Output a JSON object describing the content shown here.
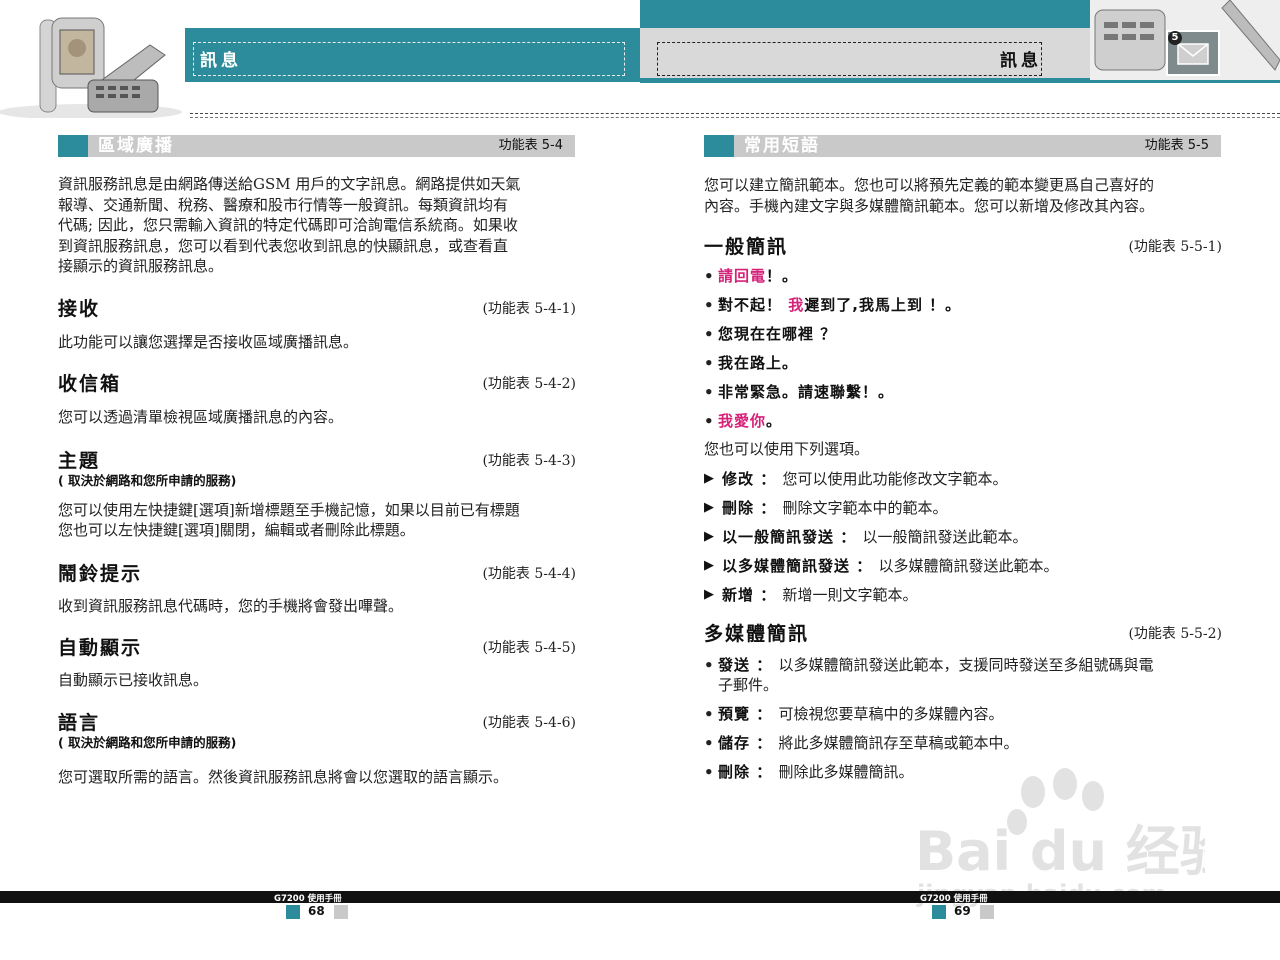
{
  "colors": {
    "teal": "#2c8c9b",
    "gray_bar": "#c9c9c9",
    "pink": "#d6237a"
  },
  "header": {
    "left_title": "訊息",
    "right_title": "訊息",
    "badge": "5",
    "icon_names": [
      "phone-flip-image",
      "envelope-icon"
    ]
  },
  "left": {
    "bar": {
      "title": "區域廣播",
      "ref": "功能表  5-4"
    },
    "intro": [
      "資訊服務訊息是由網路傳送給GSM 用戶的文字訊息。網路提供如天氣",
      "報導、交通新聞、稅務、醫療和股市行情等一般資訊。每類資訊均有",
      "代碼; 因此，您只需輸入資訊的特定代碼即可洽詢電信系統商。如果收",
      "到資訊服務訊息，您可以看到代表您收到訊息的快顯訊息，或查看直",
      "接顯示的資訊服務訊息。"
    ],
    "sections": [
      {
        "title": "接收",
        "ref": "(功能表 5-4-1)",
        "note": "",
        "body": [
          "此功能可以讓您選擇是否接收區域廣播訊息。"
        ]
      },
      {
        "title": "收信箱",
        "ref": "(功能表 5-4-2)",
        "note": "",
        "body": [
          "您可以透過清單檢視區域廣播訊息的內容。"
        ]
      },
      {
        "title": "主題",
        "ref": "(功能表 5-4-3)",
        "note": "( 取決於網路和您所申請的服務)",
        "body": [
          "您可以使用左快捷鍵[選項]新增標題至手機記憶，如果以目前已有標題",
          "您也可以左快捷鍵[選項]關閉，編輯或者刪除此標題。"
        ]
      },
      {
        "title": "鬧鈴提示",
        "ref": "(功能表 5-4-4)",
        "note": "",
        "body": [
          "收到資訊服務訊息代碼時，您的手機將會發出嗶聲。"
        ]
      },
      {
        "title": "自動顯示",
        "ref": "(功能表 5-4-5)",
        "note": "",
        "body": [
          "自動顯示已接收訊息。"
        ]
      },
      {
        "title": "語言",
        "ref": "(功能表 5-4-6)",
        "note": "( 取決於網路和您所申請的服務)",
        "body": [
          "您可選取所需的語言。然後資訊服務訊息將會以您選取的語言顯示。"
        ]
      }
    ]
  },
  "right": {
    "bar": {
      "title": "常用短語",
      "ref": "功能表  5-5"
    },
    "intro": [
      "您可以建立簡訊範本。您也可以將預先定義的範本變更爲自己喜好的",
      "內容。手機內建文字與多媒體簡訊範本。您可以新增及修改其內容。"
    ],
    "general": {
      "title": "一般簡訊",
      "ref": "(功能表 5-5-1)",
      "templates": [
        {
          "pre": "",
          "hl": "請回電",
          "post": "！。"
        },
        {
          "pre": "對不起！ ",
          "hl": "我",
          "post": "遲到了,我馬上到  ！。"
        },
        {
          "pre": "您現在在哪裡  ？",
          "hl": "",
          "post": ""
        },
        {
          "pre": "我在路上。",
          "hl": "",
          "post": ""
        },
        {
          "pre": "非常緊急。請速聯繫！。",
          "hl": "",
          "post": ""
        },
        {
          "pre": "",
          "hl": "我愛你",
          "post": "。"
        }
      ],
      "options_intro": "您也可以使用下列選項。",
      "options": [
        {
          "label": "修改",
          "sep": " ： ",
          "desc": "您可以使用此功能修改文字範本。"
        },
        {
          "label": "刪除",
          "sep": " ： ",
          "desc": "刪除文字範本中的範本。"
        },
        {
          "label": "以一般簡訊發送",
          "sep": " ： ",
          "desc": "以一般簡訊發送此範本。"
        },
        {
          "label": "以多媒體簡訊發送",
          "sep": " ： ",
          "desc": "以多媒體簡訊發送此範本。"
        },
        {
          "label": "新增",
          "sep": " ： ",
          "desc": "新增一則文字範本。"
        }
      ]
    },
    "mms": {
      "title": "多媒體簡訊",
      "ref": "(功能表 5-5-2)",
      "items": [
        {
          "label": "發送",
          "sep": " ： ",
          "desc": "以多媒體簡訊發送此範本，支援同時發送至多組號碼與電",
          "desc2": "子郵件。"
        },
        {
          "label": "預覽",
          "sep": " ： ",
          "desc": "可檢視您要草稿中的多媒體內容。",
          "desc2": ""
        },
        {
          "label": "儲存",
          "sep": " ： ",
          "desc": "將此多媒體簡訊存至草稿或範本中。",
          "desc2": ""
        },
        {
          "label": "刪除",
          "sep": " ： ",
          "desc": "刪除此多媒體簡訊。",
          "desc2": ""
        }
      ]
    }
  },
  "footer": {
    "left_label": "G7200 使用手冊",
    "left_page": "68",
    "right_label": "G7200 使用手冊",
    "right_page": "69"
  },
  "watermark": {
    "text": "Bai du 经验",
    "url": "jingyan.baidu.com"
  }
}
